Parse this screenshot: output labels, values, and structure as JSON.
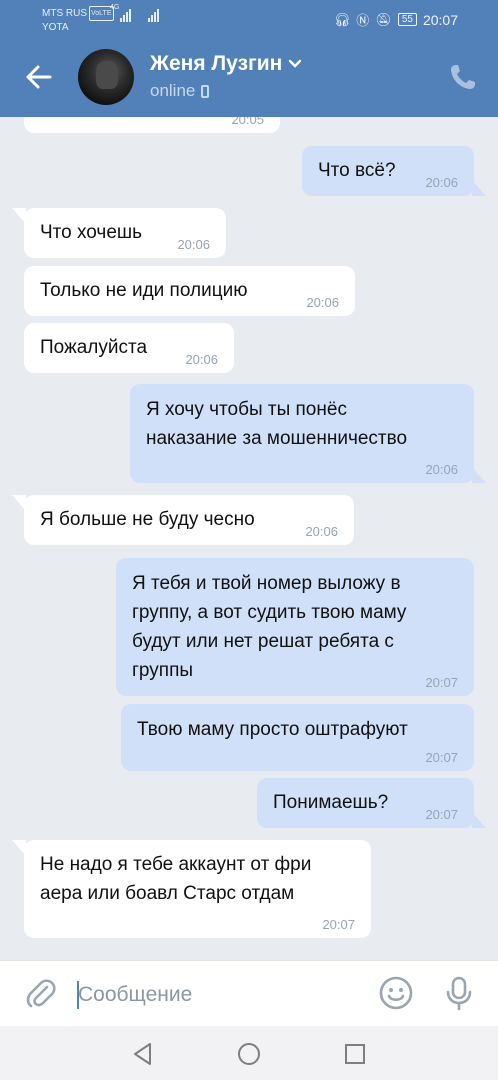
{
  "status_bar": {
    "carrier_1": "MTS RUS",
    "volte": "VoLTE",
    "signal_tag": "4G",
    "carrier_2": "YOTA",
    "battery": "55",
    "time": "20:07"
  },
  "header": {
    "contact_name": "Женя Лузгин",
    "presence": "online"
  },
  "messages": [
    {
      "dir": "in",
      "text": "",
      "time": "20:05"
    },
    {
      "dir": "out",
      "text": "Что всё?",
      "time": "20:06"
    },
    {
      "dir": "in",
      "text": "Что хочешь",
      "time": "20:06"
    },
    {
      "dir": "in",
      "text": "Только не иди полицию",
      "time": "20:06"
    },
    {
      "dir": "in",
      "text": "Пожалуйста",
      "time": "20:06"
    },
    {
      "dir": "out",
      "text": "Я хочу чтобы ты понёс\nнаказание за мошенничество",
      "time": "20:06"
    },
    {
      "dir": "in",
      "text": "Я больше не буду чесно",
      "time": "20:06"
    },
    {
      "dir": "out",
      "text": "Я тебя и твой номер выложу в\nгруппу, а вот судить твою маму\nбудут или нет решат ребята с\nгруппы",
      "time": "20:07"
    },
    {
      "dir": "out",
      "text": "Твою маму просто оштрафуют",
      "time": "20:07"
    },
    {
      "dir": "out",
      "text": "Понимаешь?",
      "time": "20:07"
    },
    {
      "dir": "in",
      "text": "Не надо я тебе аккаунт от фри\nаера или боавл Старс отдам",
      "time": "20:07"
    }
  ],
  "composer": {
    "placeholder": "Сообщение"
  },
  "icons": {
    "back": "arrow-left-icon",
    "call": "phone-icon",
    "attach": "paperclip-icon",
    "emoji": "smiley-icon",
    "mic": "microphone-icon",
    "nav_back": "triangle-back-icon",
    "nav_home": "circle-home-icon",
    "nav_recent": "square-recents-icon"
  },
  "colors": {
    "header": "#5181b8",
    "incoming_bubble": "#ffffff",
    "outgoing_bubble": "#cfe0f8",
    "chat_background": "#e8ecf1"
  }
}
